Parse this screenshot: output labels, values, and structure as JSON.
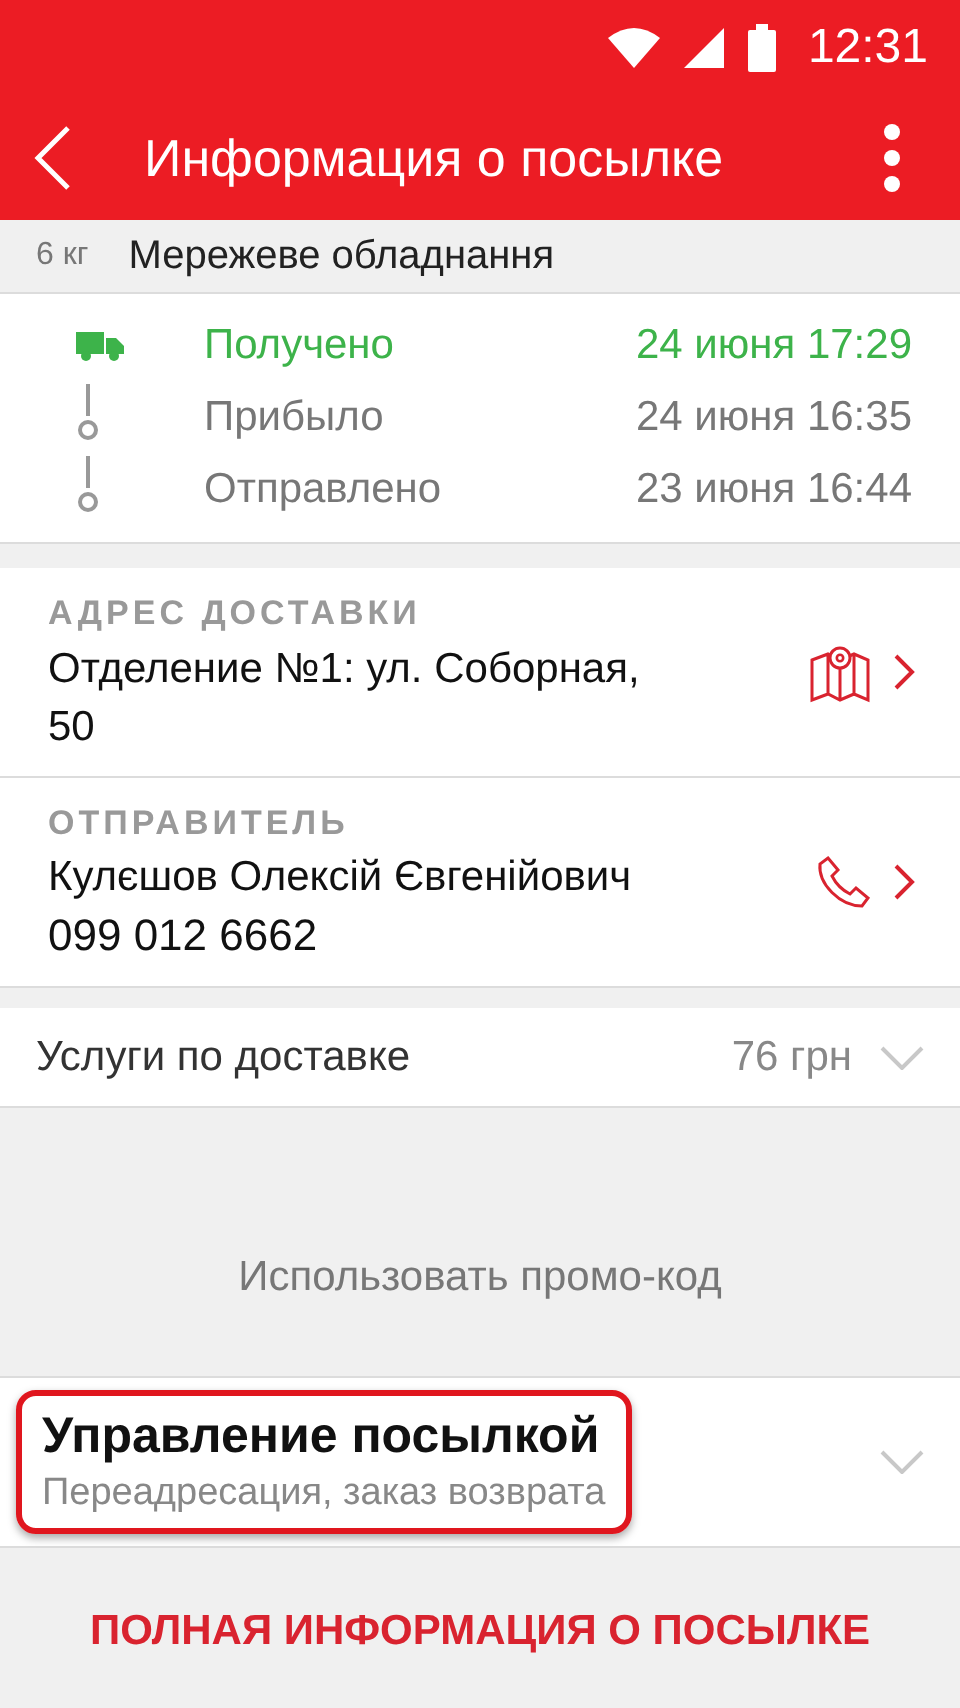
{
  "status_bar": {
    "time": "12:31"
  },
  "app_bar": {
    "title": "Информация о посылке"
  },
  "parcel": {
    "weight": "6 кг",
    "description": "Мережеве обладнання"
  },
  "tracking": [
    {
      "status": "Получено",
      "date": "24 июня 17:29",
      "active": true
    },
    {
      "status": "Прибыло",
      "date": "24 июня 16:35",
      "active": false
    },
    {
      "status": "Отправлено",
      "date": "23 июня 16:44",
      "active": false
    }
  ],
  "delivery_address": {
    "label": "АДРЕС ДОСТАВКИ",
    "value": "Отделение №1: ул. Соборная, 50"
  },
  "sender": {
    "label": "ОТПРАВИТЕЛЬ",
    "name": "Кулєшов Олексій Євгенійович",
    "phone": "099 012 6662"
  },
  "services": {
    "label": "Услуги по доставке",
    "price": "76 грн"
  },
  "promo": {
    "label": "Использовать промо-код"
  },
  "manage": {
    "title": "Управление посылкой",
    "subtitle": "Переадресация, заказ возврата",
    "highlighted": true
  },
  "full_info": {
    "label": "ПОЛНАЯ ИНФОРМАЦИЯ О ПОСЫЛКЕ"
  }
}
